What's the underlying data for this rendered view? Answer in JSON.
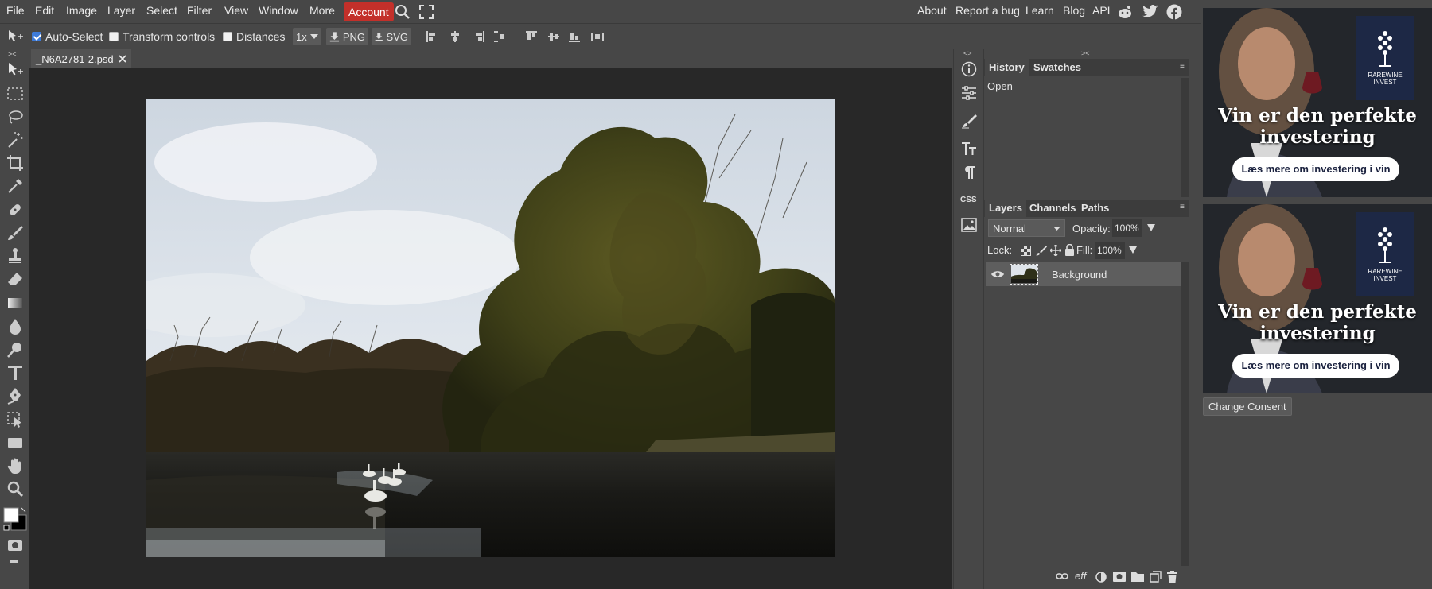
{
  "menu": {
    "items": [
      "File",
      "Edit",
      "Image",
      "Layer",
      "Select",
      "Filter",
      "View",
      "Window",
      "More"
    ],
    "account_label": "Account",
    "right_links": [
      "About",
      "Report a bug",
      "Learn",
      "Blog",
      "API"
    ]
  },
  "options": {
    "auto_select": "Auto-Select",
    "auto_select_checked": true,
    "transform_controls": "Transform controls",
    "distances": "Distances",
    "zoom": "1x",
    "png": "PNG",
    "svg": "SVG"
  },
  "document": {
    "tab_name": "_N6A2781-2.psd"
  },
  "history_panel": {
    "tabs": [
      "History",
      "Swatches"
    ],
    "entries": [
      "Open"
    ]
  },
  "layers_panel": {
    "tabs": [
      "Layers",
      "Channels",
      "Paths"
    ],
    "blend_mode": "Normal",
    "opacity_label": "Opacity:",
    "opacity_value": "100%",
    "lock_label": "Lock:",
    "fill_label": "Fill:",
    "fill_value": "100%",
    "layers": [
      {
        "name": "Background"
      }
    ],
    "footer_icons": [
      "link-icon",
      "effects-icon",
      "adjustment-icon",
      "mask-icon",
      "folder-icon",
      "new-layer-icon",
      "trash-icon"
    ],
    "effects_glyph": "eff"
  },
  "icon_column": {
    "css_label": "CSS"
  },
  "ads": [
    {
      "headline": "Vin er den perfekte investering",
      "cta": "Læs mere om investering i vin",
      "logo": "RAREWINE INVEST"
    },
    {
      "headline": "Vin er den perfekte investering",
      "cta": "Læs mere om investering i vin",
      "logo": "RAREWINE INVEST"
    }
  ],
  "change_consent": "Change Consent",
  "colors": {
    "accent": "#c3302a",
    "panel_bg": "#474747",
    "canvas_bg": "#282828"
  }
}
